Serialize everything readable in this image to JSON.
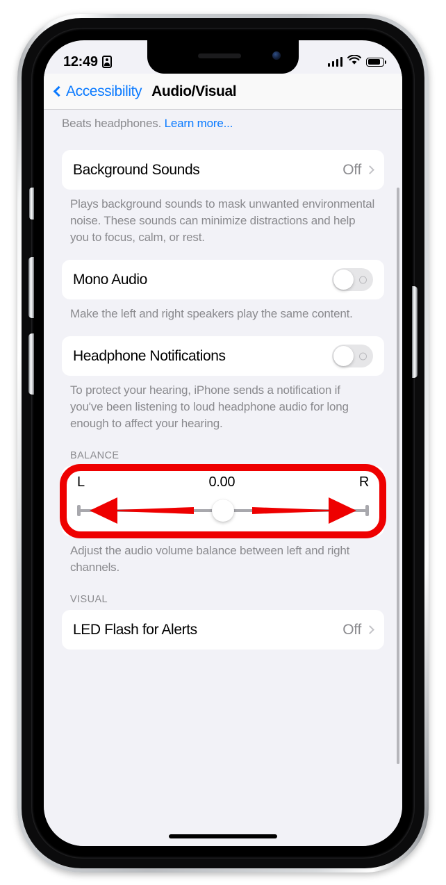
{
  "device": {
    "hardware": {
      "silent_switch": "silent-switch",
      "volume_up": "volume-up-button",
      "volume_down": "volume-down-button",
      "power": "power-button"
    }
  },
  "status_bar": {
    "time": "12:49",
    "badge_icon": "personal-hotspot-icon",
    "cellular_icon": "cellular-signal-icon",
    "cellular_bars": 4,
    "wifi_icon": "wifi-icon",
    "battery_icon": "battery-icon",
    "battery_level": 70
  },
  "nav_bar": {
    "back_label": "Accessibility",
    "back_icon": "chevron-left-icon",
    "title": "Audio/Visual"
  },
  "content": {
    "partial_footnote": {
      "text": "Beats headphones. ",
      "link": "Learn more..."
    },
    "sections": [
      {
        "header": "",
        "rows": [
          {
            "label": "Background Sounds",
            "value": "Off",
            "type": "disclosure",
            "name": "row-background-sounds"
          }
        ],
        "footnote": "Plays background sounds to mask unwanted environmental noise. These sounds can minimize distractions and help you to focus, calm, or rest."
      },
      {
        "header": "",
        "rows": [
          {
            "label": "Mono Audio",
            "value": "Off",
            "type": "toggle",
            "name": "row-mono-audio"
          }
        ],
        "footnote": "Make the left and right speakers play the same content."
      },
      {
        "header": "",
        "rows": [
          {
            "label": "Headphone Notifications",
            "value": "Off",
            "type": "toggle",
            "name": "row-headphone-notifications"
          }
        ],
        "footnote": "To protect your hearing, iPhone sends a notification if you've been listening to loud headphone audio for long enough to affect your hearing."
      }
    ],
    "balance": {
      "header": "BALANCE",
      "left_label": "L",
      "right_label": "R",
      "value": "0.00",
      "min": -1.0,
      "max": 1.0,
      "footnote": "Adjust the audio volume balance between left and right channels."
    },
    "visual": {
      "header": "VISUAL",
      "rows": [
        {
          "label": "LED Flash for Alerts",
          "value": "Off",
          "type": "disclosure",
          "name": "row-led-flash-for-alerts"
        }
      ]
    }
  },
  "annotation": {
    "highlight_color": "#ee0000",
    "arrow_left_icon": "arrow-left-annotation",
    "arrow_right_icon": "arrow-right-annotation",
    "target": "balance-slider"
  },
  "colors": {
    "accent_blue": "#0a7aff",
    "background": "#f2f2f7",
    "card": "#ffffff",
    "secondary_text": "#8a8a8e",
    "annotation_red": "#ee0000"
  }
}
